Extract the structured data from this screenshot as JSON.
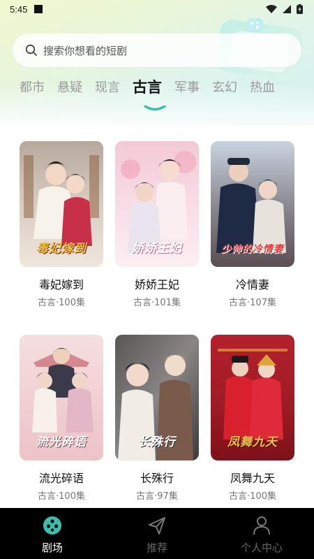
{
  "status_bar": {
    "time": "5:45"
  },
  "search": {
    "placeholder": "搜索你想看的短剧"
  },
  "tabs": [
    {
      "label": "都市",
      "active": false
    },
    {
      "label": "悬疑",
      "active": false
    },
    {
      "label": "现言",
      "active": false
    },
    {
      "label": "古言",
      "active": true
    },
    {
      "label": "军事",
      "active": false
    },
    {
      "label": "玄幻",
      "active": false
    },
    {
      "label": "热血",
      "active": false
    }
  ],
  "dramas": [
    {
      "title": "毒妃嫁到",
      "meta": "古言·100集",
      "poster_text": "毒妃嫁到"
    },
    {
      "title": "娇娇王妃",
      "meta": "古言·101集",
      "poster_text": "娇娇王妃"
    },
    {
      "title": "冷情妻",
      "meta": "古言·107集",
      "poster_text": "少帅的冷情妻"
    },
    {
      "title": "流光碎语",
      "meta": "古言·100集",
      "poster_text": "流光碎语"
    },
    {
      "title": "长殊行",
      "meta": "古言·97集",
      "poster_text": "长殊行"
    },
    {
      "title": "凤舞九天",
      "meta": "古言·100集",
      "poster_text": "凤舞九天"
    }
  ],
  "bottom_nav": [
    {
      "label": "剧场",
      "icon": "film-reel-icon",
      "active": true
    },
    {
      "label": "推荐",
      "icon": "send-arrow-icon",
      "active": false
    },
    {
      "label": "个人中心",
      "icon": "person-icon",
      "active": false
    }
  ],
  "colors": {
    "accent": "#3bbfad",
    "nav_bg": "#000000",
    "header_gradient_start": "#f1f8cf",
    "header_gradient_end": "#d4f0ef"
  }
}
